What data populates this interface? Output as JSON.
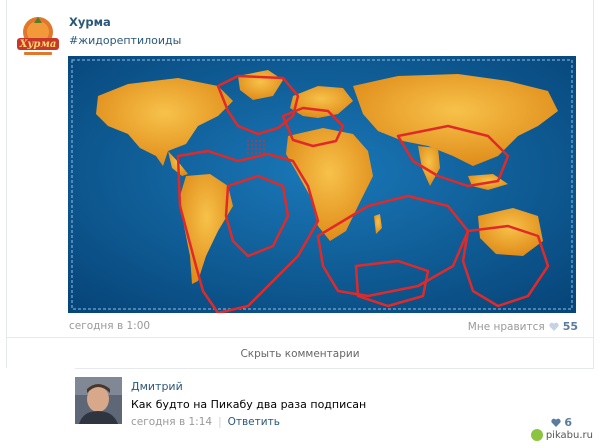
{
  "post": {
    "group_name": "Хурма",
    "hashtag": "#жидорептилоиды",
    "avatar_text": "Хурма",
    "date": "сегодня в 1:00",
    "like_label": "Мне нравится",
    "like_count": "55",
    "image_icon": "world-map-icon"
  },
  "hide_comments_label": "Скрыть комментарии",
  "comment": {
    "author": "Дмитрий",
    "text": "Как будто на Пикабу два раза подписан",
    "date": "сегодня в 1:14",
    "reply_label": "Ответить",
    "like_count": "6"
  },
  "watermark": {
    "text": "pikabu.ru"
  },
  "colors": {
    "link": "#2b587a",
    "ocean": "#0b5b97",
    "land": "#f0a52a",
    "outline": "#e02a2a",
    "meta": "#999999"
  }
}
